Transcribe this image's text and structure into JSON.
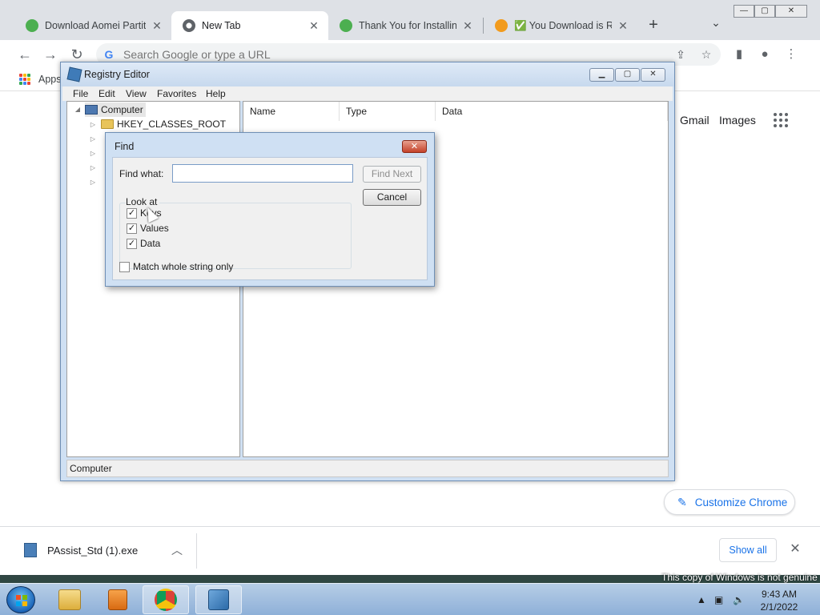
{
  "chrome": {
    "tabs": [
      {
        "title": "Download Aomei Partiti",
        "active": false
      },
      {
        "title": "New Tab",
        "active": true
      },
      {
        "title": "Thank You for Installing",
        "active": false
      },
      {
        "title": "✅ You Download is Rea",
        "active": false
      }
    ],
    "new_tab_symbol": "+",
    "tab_search_symbol": "⌄",
    "window_controls": {
      "minimize": "—",
      "maximize": "▢",
      "close": "✕"
    },
    "omnibox_placeholder": "Search Google or type a URL",
    "bookmarks": {
      "apps_label": "Apps"
    },
    "ntp": {
      "gmail": "Gmail",
      "images": "Images",
      "customize_label": "Customize Chrome"
    },
    "downloads": {
      "file_name": "PAssist_Std (1).exe",
      "show_all": "Show all"
    }
  },
  "regedit": {
    "title": "Registry Editor",
    "menu": [
      "File",
      "Edit",
      "View",
      "Favorites",
      "Help"
    ],
    "tree": {
      "root": "Computer",
      "first_key": "HKEY_CLASSES_ROOT"
    },
    "columns": [
      "Name",
      "Type",
      "Data"
    ],
    "status": "Computer"
  },
  "find_dialog": {
    "title": "Find",
    "find_what_label": "Find what:",
    "find_what_value": "",
    "find_next": "Find Next",
    "cancel": "Cancel",
    "look_at_label": "Look at",
    "checkboxes": [
      {
        "label": "Keys",
        "checked": true
      },
      {
        "label": "Values",
        "checked": true
      },
      {
        "label": "Data",
        "checked": true
      }
    ],
    "match_whole": {
      "label": "Match whole string only",
      "checked": false
    }
  },
  "desktop": {
    "watermark": "This copy of Windows is not genuine"
  },
  "taskbar": {
    "apps": [
      "explorer-icon",
      "media-player-icon",
      "chrome-icon",
      "regedit-icon"
    ],
    "time": "9:43 AM",
    "date": "2/1/2022"
  },
  "colors": {
    "accent": "#1a73e8",
    "tabstrip": "#dee1e6",
    "dialog_frame": "#cfe0f3"
  }
}
